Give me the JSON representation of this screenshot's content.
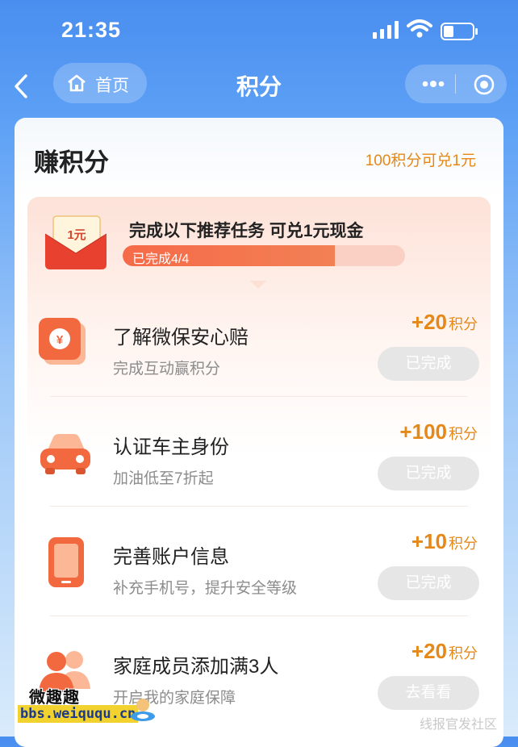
{
  "status": {
    "time": "21:35"
  },
  "nav": {
    "home_label": "首页",
    "title": "积分"
  },
  "earn": {
    "title": "赚积分",
    "exchange_note": "100积分可兑1元"
  },
  "banner": {
    "envelope_text": "1元",
    "headline": "完成以下推荐任务 可兑1元现金",
    "progress_label": "已完成4/4",
    "progress_fraction": 0.75
  },
  "tasks": [
    {
      "icon": "yuan-card-icon",
      "title": "了解微保安心赔",
      "subtitle": "完成互动赢积分",
      "points": "+20",
      "unit": "积分",
      "button": "已完成"
    },
    {
      "icon": "car-icon",
      "title": "认证车主身份",
      "subtitle": "加油低至7折起",
      "points": "+100",
      "unit": "积分",
      "button": "已完成"
    },
    {
      "icon": "phone-icon",
      "title": "完善账户信息",
      "subtitle": "补充手机号，提升安全等级",
      "points": "+10",
      "unit": "积分",
      "button": "已完成"
    },
    {
      "icon": "family-icon",
      "title": "家庭成员添加满3人",
      "subtitle": "开启我的家庭保障",
      "points": "+20",
      "unit": "积分",
      "button": "去看看"
    }
  ],
  "watermark": {
    "line1": "微趣趣",
    "line2": "bbs.weiququ.cn",
    "right": "线报官发社区"
  },
  "colors": {
    "accent": "#e58818",
    "progress": "#f66a48",
    "nav_blue": "#4a8ef0"
  }
}
